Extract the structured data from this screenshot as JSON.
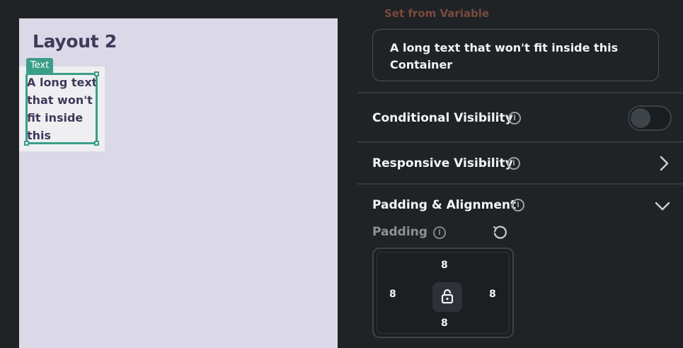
{
  "canvas": {
    "layout_title": "Layout 2",
    "text_tag": "Text",
    "selected_text": "A long text that won't fit inside this"
  },
  "panel": {
    "set_from_variable": "Set from Variable",
    "value_text": "A long text that won't fit inside this Container",
    "conditional_visibility": {
      "label": "Conditional Visibility",
      "enabled": false
    },
    "responsive_visibility": {
      "label": "Responsive Visibility"
    },
    "padding_alignment": {
      "label": "Padding & Alignment"
    },
    "padding": {
      "label": "Padding",
      "top": "8",
      "left": "8",
      "right": "8",
      "bottom": "8"
    }
  },
  "icons": {
    "info": "info-icon",
    "reset": "reset-icon",
    "lock": "lock-icon",
    "chevron_right": "chevron-right-icon",
    "chevron_down": "chevron-down-icon"
  },
  "colors": {
    "selection_accent": "#3a9e88",
    "frame_background": "#dbd9e8",
    "panel_background": "#1f2326",
    "variable_label": "#7a4a3e"
  }
}
